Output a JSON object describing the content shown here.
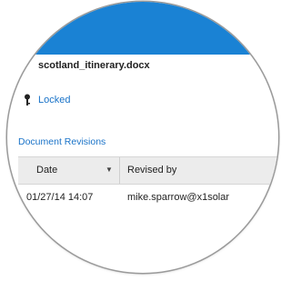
{
  "document": {
    "file_name": "scotland_itinerary.docx",
    "lock_status": "Locked"
  },
  "revisions": {
    "section_title": "Document Revisions",
    "columns": {
      "date": "Date",
      "revised_by": "Revised by"
    },
    "rows": [
      {
        "date": "01/27/14 14:07",
        "revised_by": "mike.sparrow@x1solar"
      }
    ]
  },
  "colors": {
    "header_blue": "#1a82d4",
    "link_blue": "#1a73c8",
    "table_header_bg": "#ececec"
  },
  "icons": {
    "lock": "key-icon",
    "sort": "sort-desc-icon",
    "attachment": "paperclip-icon"
  }
}
